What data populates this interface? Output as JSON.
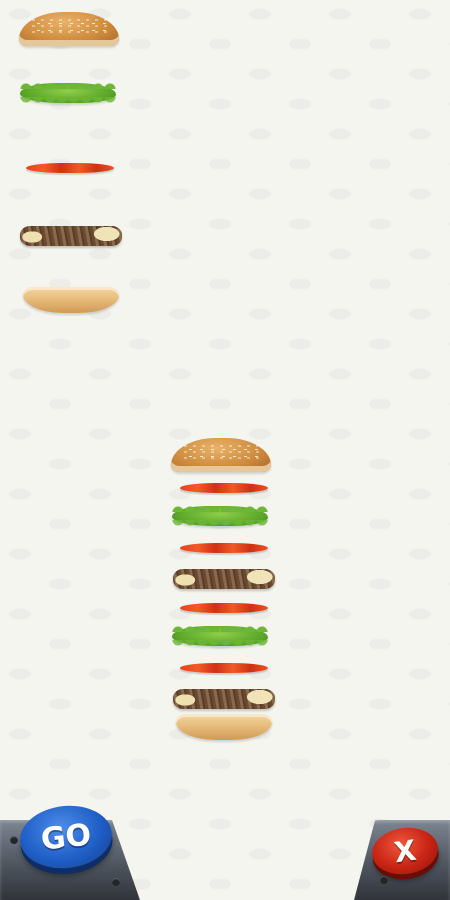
{
  "ingredient_menu": [
    {
      "kind": "bun-top",
      "icon": "top-bun-icon"
    },
    {
      "kind": "lettuce",
      "icon": "lettuce-icon"
    },
    {
      "kind": "tomato",
      "icon": "tomato-icon"
    },
    {
      "kind": "patty",
      "icon": "patty-icon"
    },
    {
      "kind": "bun-bottom",
      "icon": "bottom-bun-icon"
    }
  ],
  "burger_stack": [
    "bun-top",
    "tomato",
    "lettuce",
    "tomato",
    "patty",
    "tomato",
    "lettuce",
    "tomato",
    "patty",
    "bun-bottom"
  ],
  "controls": {
    "go_label": "GO",
    "cancel_label": "X"
  },
  "colors": {
    "go_button": "#1f5fc7",
    "cancel_button": "#c72414",
    "background": "#f5f5f0"
  }
}
